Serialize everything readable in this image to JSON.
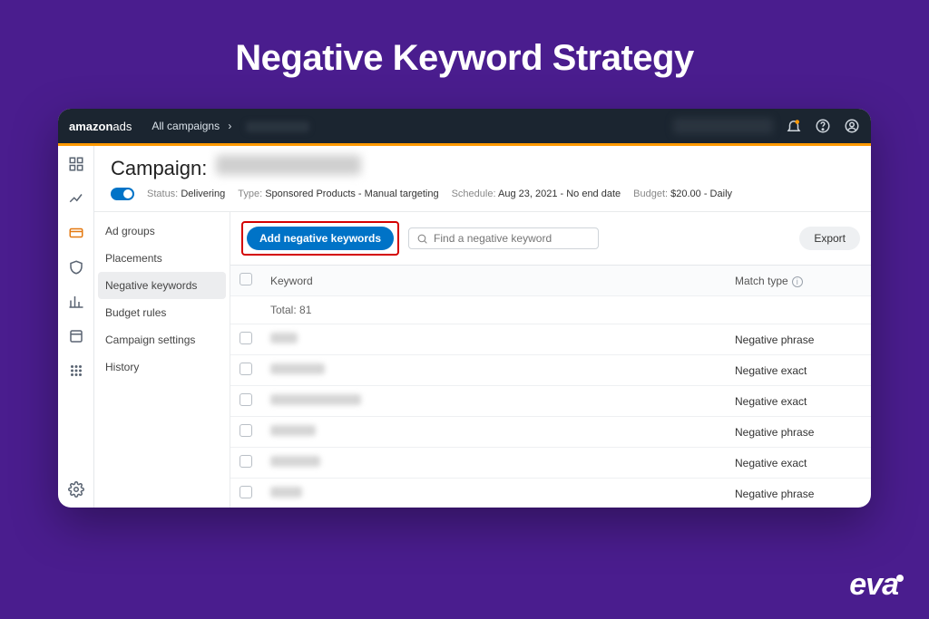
{
  "hero": {
    "title": "Negative Keyword Strategy"
  },
  "topbar": {
    "brand": "amazon",
    "brand_suffix": "ads",
    "breadcrumb_root": "All campaigns"
  },
  "campaign": {
    "label": "Campaign:",
    "status_label": "Status:",
    "status_value": "Delivering",
    "type_label": "Type:",
    "type_value": "Sponsored Products - Manual targeting",
    "schedule_label": "Schedule:",
    "schedule_value": "Aug 23, 2021 - No end date",
    "budget_label": "Budget:",
    "budget_value": "$20.00 - Daily"
  },
  "leftnav": {
    "items": [
      {
        "label": "Ad groups",
        "selected": false
      },
      {
        "label": "Placements",
        "selected": false
      },
      {
        "label": "Negative keywords",
        "selected": true
      },
      {
        "label": "Budget rules",
        "selected": false
      },
      {
        "label": "Campaign settings",
        "selected": false
      },
      {
        "label": "History",
        "selected": false
      }
    ]
  },
  "actions": {
    "add_button": "Add negative keywords",
    "search_placeholder": "Find a negative keyword",
    "export": "Export"
  },
  "table": {
    "col_keyword": "Keyword",
    "col_matchtype": "Match type",
    "total_label": "Total:",
    "total_value": "81",
    "rows": [
      {
        "match": "Negative phrase"
      },
      {
        "match": "Negative exact"
      },
      {
        "match": "Negative exact"
      },
      {
        "match": "Negative phrase"
      },
      {
        "match": "Negative exact"
      },
      {
        "match": "Negative phrase"
      }
    ]
  },
  "footer": {
    "brand": "eva"
  }
}
